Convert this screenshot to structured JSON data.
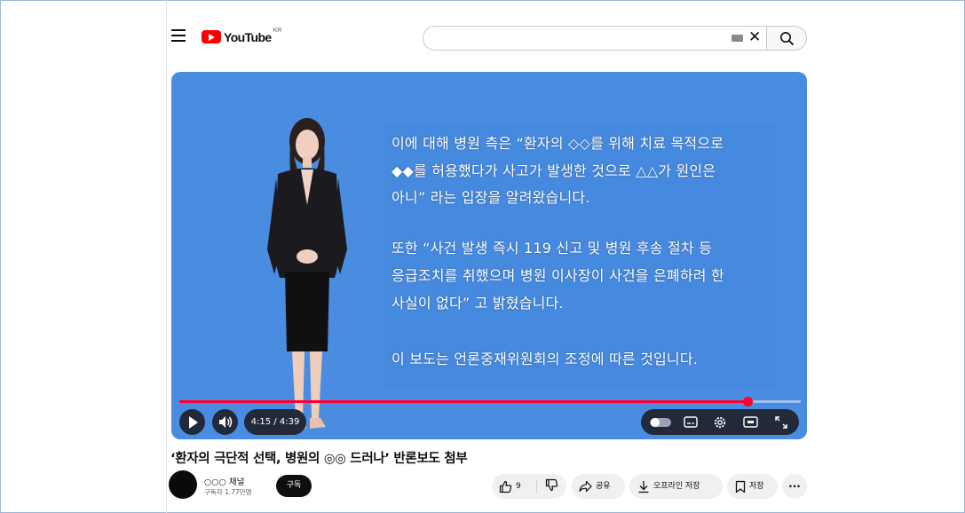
{
  "header": {
    "logo_text": "YouTube",
    "logo_region": "KR",
    "search": {
      "value": "",
      "placeholder": ""
    }
  },
  "player": {
    "caption_lines": [
      "이에 대해 병원 측은 “환자의 ◇◇를 위해 치료 목적으로",
      "◆◆를 허용했다가 사고가 발생한 것으로 △△가 원인은",
      "아니” 라는 입장을 알려왔습니다.",
      "또한 “사건 발생 즉시 119 신고 및 병원 후송 절차 등",
      "응급조치를 취했으며 병원 이사장이 사건을 은폐하려 한",
      "사실이 없다” 고 밝혔습니다.",
      "이 보도는 언론중재위원회의 조정에 따른 것입니다."
    ],
    "time_display": "4:15 / 4:39",
    "progress_fraction": 0.914,
    "accent_color": "#ff0033",
    "background_color": "#4a8de0"
  },
  "video": {
    "title": "‘환자의 극단적 선택, 병원의 ◎◎ 드러나’ 반론보도 첨부",
    "channel_name": "○○○ 채널",
    "channel_subscribers": "구독자 1.77만명",
    "subscribe_label": "구독"
  },
  "actions": {
    "like_count": "9",
    "share_label": "공유",
    "offline_label": "오프라인 저장",
    "save_label": "저장",
    "more_label": "···"
  },
  "icons": [
    "menu-icon",
    "play-icon",
    "volume-icon",
    "autoplay-toggle-icon",
    "subtitles-icon",
    "settings-icon",
    "theater-icon",
    "fullscreen-icon",
    "thumbs-up-icon",
    "thumbs-down-icon",
    "share-icon",
    "download-icon",
    "bookmark-icon",
    "search-icon",
    "close-icon",
    "keyboard-icon"
  ]
}
